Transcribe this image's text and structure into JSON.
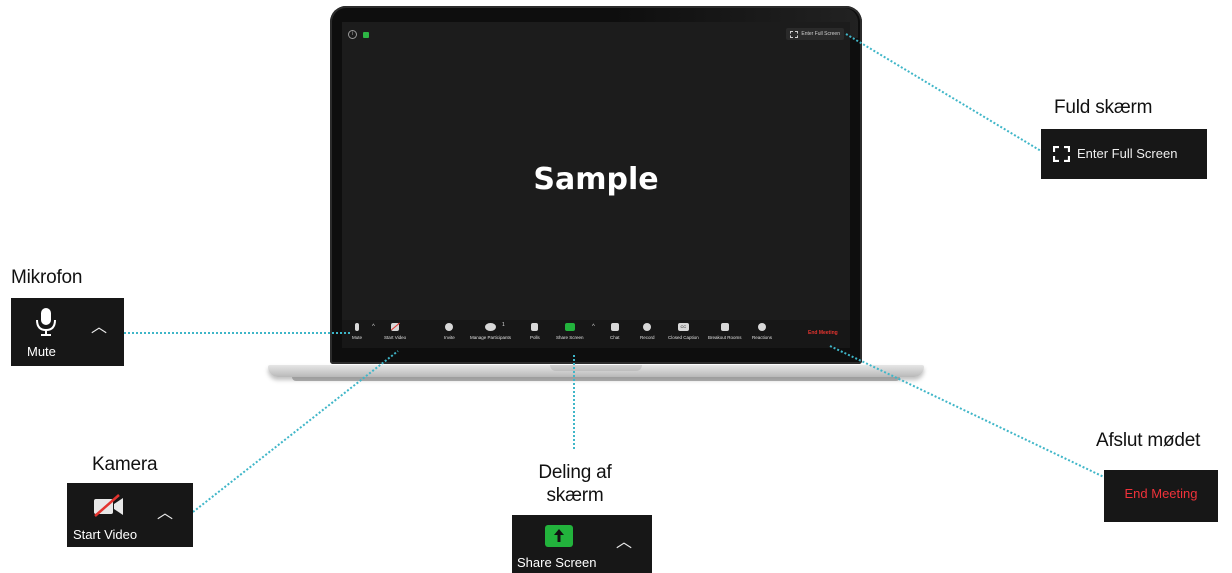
{
  "screen": {
    "sample_text": "Sample",
    "fullscreen_label": "Enter Full Screen",
    "toolbar": {
      "mute": "Mute",
      "start_video": "Start Video",
      "invite": "Invite",
      "manage_participants": "Manage Participants",
      "participant_count": "1",
      "polls": "Polls",
      "share_screen": "Share Screen",
      "chat": "Chat",
      "record": "Record",
      "closed_caption": "Closed Caption",
      "cc_badge": "CC",
      "breakout_rooms": "Breakout Rooms",
      "reactions": "Reactions",
      "end_meeting": "End Meeting"
    }
  },
  "callouts": {
    "mikrofon": {
      "title": "Mikrofon",
      "button_label": "Mute",
      "icon": "microphone-icon"
    },
    "kamera": {
      "title": "Kamera",
      "button_label": "Start Video",
      "icon": "video-off-icon"
    },
    "deling": {
      "title_line1": "Deling af",
      "title_line2": "skærm",
      "button_label": "Share Screen",
      "icon": "share-arrow-icon"
    },
    "fuld_skaerm": {
      "title": "Fuld skærm",
      "button_label": "Enter Full Screen",
      "icon": "fullscreen-icon"
    },
    "afslut": {
      "title": "Afslut mødet",
      "button_label": "End Meeting"
    }
  },
  "colors": {
    "connector": "#3fb6c8",
    "panel_bg": "#171717",
    "share_green": "#22b33c",
    "end_red": "#f0323a"
  }
}
